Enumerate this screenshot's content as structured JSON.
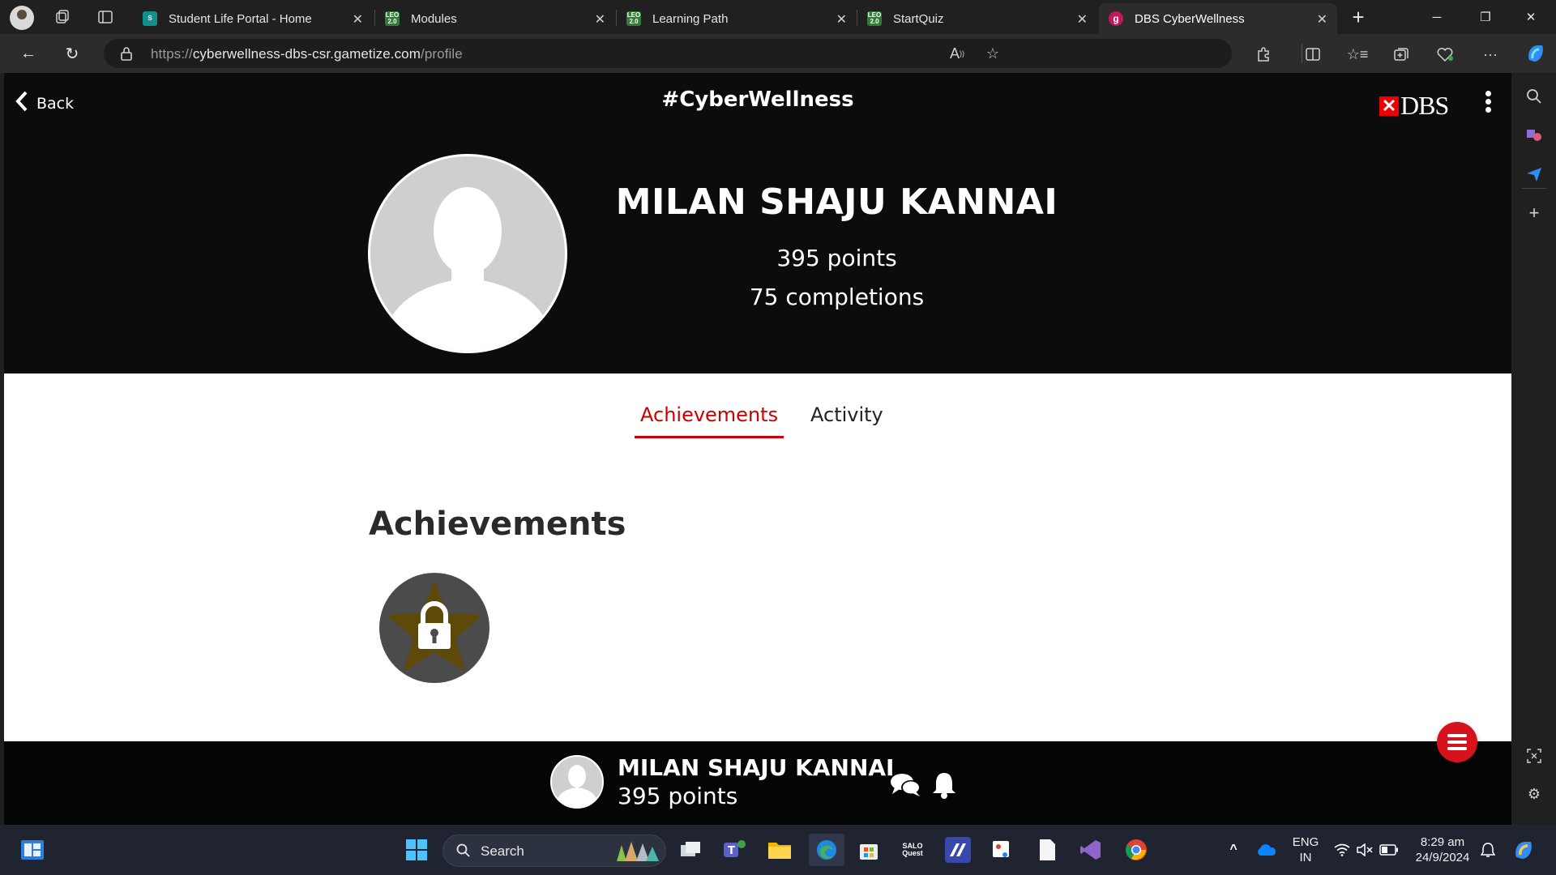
{
  "browser": {
    "tabs": [
      {
        "title": "Student Life Portal - Home",
        "favicon": "sharepoint-icon",
        "active": false
      },
      {
        "title": "Modules",
        "favicon": "leo-icon",
        "active": false
      },
      {
        "title": "Learning Path",
        "favicon": "leo-icon",
        "active": false
      },
      {
        "title": "StartQuiz",
        "favicon": "leo-icon",
        "active": false
      },
      {
        "title": "DBS CyberWellness",
        "favicon": "gametize-icon",
        "active": true
      }
    ],
    "favicon_text": {
      "leo": "LEO 2.0",
      "gametize": "g"
    },
    "url_scheme": "https://",
    "url_host": "cyberwellness-dbs-csr.gametize.com",
    "url_path": "/profile",
    "accent_color": "#c00000"
  },
  "header": {
    "back_label": "Back",
    "site_title": "#CyberWellness",
    "brand_logo_text": "DBS"
  },
  "profile": {
    "name": "MILAN SHAJU KANNAI",
    "points": "395 points",
    "completions": "75 completions"
  },
  "tabs": {
    "achievements": "Achievements",
    "activity": "Activity",
    "active": "achievements"
  },
  "achievements": {
    "section_title": "Achievements",
    "items": [
      {
        "icon": "locked-star-icon",
        "locked": true
      }
    ]
  },
  "bottom_bar": {
    "name": "MILAN SHAJU KANNAI",
    "points": "395 points"
  },
  "taskbar": {
    "search_label": "Search",
    "language_line1": "ENG",
    "language_line2": "IN",
    "time": "8:29 am",
    "date": "24/9/2024",
    "app_labels": {
      "quest": "SALO Quest"
    }
  }
}
